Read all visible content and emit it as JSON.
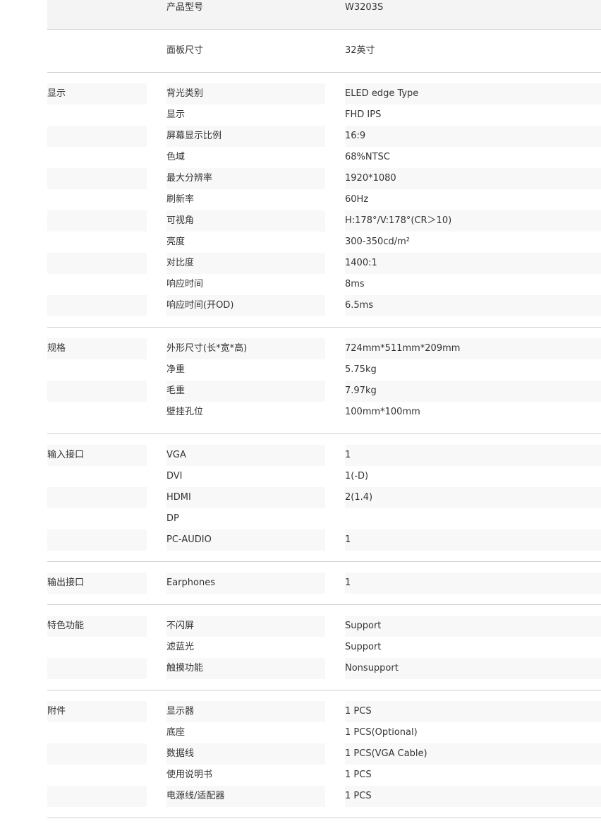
{
  "sections": [
    {
      "category": "",
      "rows": [
        {
          "name": "产品型号",
          "value": "W3203S"
        }
      ]
    },
    {
      "category": "",
      "rows": [
        {
          "name": "面板尺寸",
          "value": "32英寸"
        }
      ]
    },
    {
      "category": "显示",
      "rows": [
        {
          "name": "背光类别",
          "value": "ELED edge Type"
        },
        {
          "name": "显示",
          "value": "FHD IPS"
        },
        {
          "name": "屏幕显示比例",
          "value": "16:9"
        },
        {
          "name": "色域",
          "value": "68%NTSC"
        },
        {
          "name": "最大分辨率",
          "value": "1920*1080"
        },
        {
          "name": "刷新率",
          "value": "60Hz"
        },
        {
          "name": "可视角",
          "value": "H:178°/V:178°(CR＞10)"
        },
        {
          "name": "亮度",
          "value": "300-350cd/m²"
        },
        {
          "name": "对比度",
          "value": "1400:1"
        },
        {
          "name": "响应时间",
          "value": "8ms"
        },
        {
          "name": "响应时间(开OD)",
          "value": "6.5ms"
        }
      ]
    },
    {
      "category": "规格",
      "rows": [
        {
          "name": "外形尺寸(长*宽*高)",
          "value": "724mm*511mm*209mm"
        },
        {
          "name": "净重",
          "value": "5.75kg"
        },
        {
          "name": "毛重",
          "value": "7.97kg"
        },
        {
          "name": "壁挂孔位",
          "value": "100mm*100mm"
        }
      ]
    },
    {
      "category": "输入接口",
      "rows": [
        {
          "name": "VGA",
          "value": "1"
        },
        {
          "name": "DVI",
          "value": "1(-D)"
        },
        {
          "name": "HDMI",
          "value": "2(1.4)"
        },
        {
          "name": "DP",
          "value": ""
        },
        {
          "name": "PC-AUDIO",
          "value": "1"
        }
      ]
    },
    {
      "category": "输出接口",
      "rows": [
        {
          "name": "Earphones",
          "value": "1"
        }
      ]
    },
    {
      "category": "特色功能",
      "rows": [
        {
          "name": "不闪屏",
          "value": "Support"
        },
        {
          "name": "滤蓝光",
          "value": "Support"
        },
        {
          "name": "触摸功能",
          "value": "Nonsupport"
        }
      ]
    },
    {
      "category": "附件",
      "rows": [
        {
          "name": "显示器",
          "value": "1 PCS"
        },
        {
          "name": "底座",
          "value": "1 PCS(Optional)"
        },
        {
          "name": "数据线",
          "value": "1 PCS(VGA Cable)"
        },
        {
          "name": "使用说明书",
          "value": "1 PCS"
        },
        {
          "name": "电源线/适配器",
          "value": "1 PCS"
        }
      ]
    }
  ]
}
